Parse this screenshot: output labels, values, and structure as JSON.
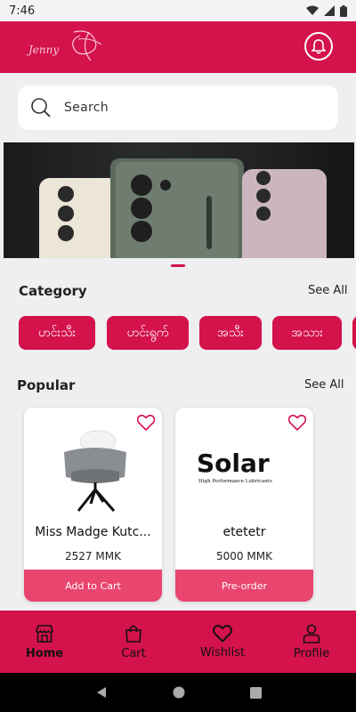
{
  "status_bar": {
    "time": "7:46"
  },
  "app_bar": {
    "logo_text": "Jenny"
  },
  "search": {
    "placeholder": "Search"
  },
  "category": {
    "title": "Category",
    "see_all": "See All",
    "chips": [
      "ဟင်းသီး",
      "ဟင်းရွက်",
      "အသီး",
      "အသား"
    ]
  },
  "popular": {
    "title": "Popular",
    "see_all": "See All",
    "products": [
      {
        "name": "Miss Madge Kutc...",
        "price": "2527 MMK",
        "button": "Add to Cart"
      },
      {
        "name": "etetetr",
        "price": "5000 MMK",
        "button": "Pre-order",
        "logo_text": "Solar",
        "logo_sub": "High Performance Lubricants"
      }
    ]
  },
  "bottom_nav": {
    "items": [
      {
        "label": "Home",
        "icon": "store-icon"
      },
      {
        "label": "Cart",
        "icon": "bag-icon"
      },
      {
        "label": "Wishlist",
        "icon": "heart-icon"
      },
      {
        "label": "Profile",
        "icon": "person-icon"
      }
    ]
  },
  "colors": {
    "primary": "#d4124b",
    "button": "#e8456f",
    "background": "#efeef0"
  }
}
